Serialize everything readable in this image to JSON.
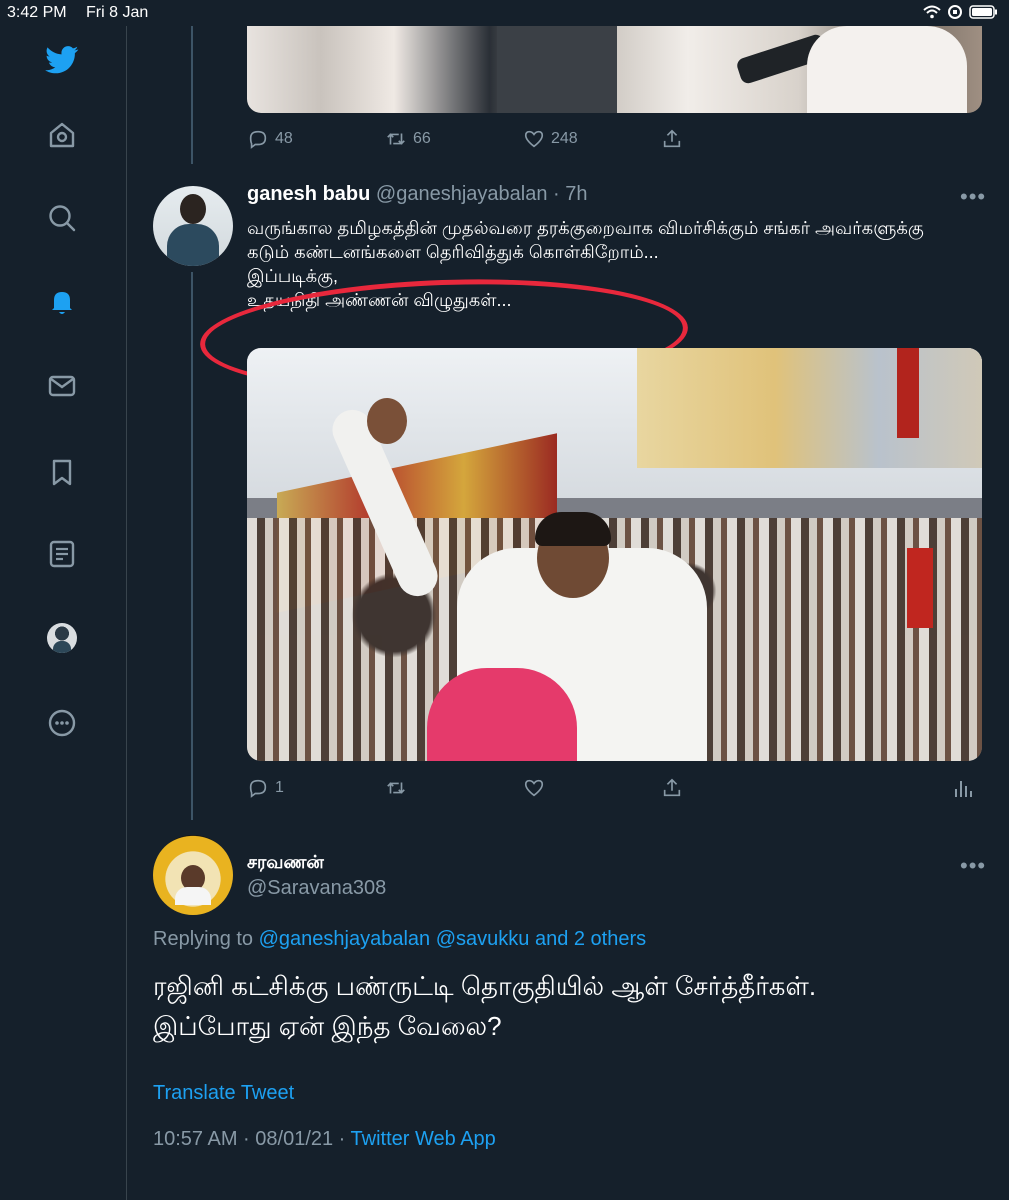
{
  "status_bar": {
    "time": "3:42 PM",
    "date": "Fri 8 Jan"
  },
  "sidebar": {
    "items": [
      {
        "name": "twitter-logo"
      },
      {
        "name": "home"
      },
      {
        "name": "explore"
      },
      {
        "name": "notifications",
        "active": true
      },
      {
        "name": "messages"
      },
      {
        "name": "bookmarks"
      },
      {
        "name": "lists"
      },
      {
        "name": "profile"
      },
      {
        "name": "more"
      }
    ]
  },
  "prev_tweet": {
    "stats": {
      "replies": "48",
      "retweets": "66",
      "likes": "248"
    }
  },
  "tweet": {
    "name": "ganesh babu",
    "handle": "@ganeshjayabalan",
    "time": "· 7h",
    "text": "வருங்கால தமிழகத்தின் முதல்வரை தரக்குறைவாக விமர்சிக்கும் சங்கர் அவர்களுக்கு கடும் கண்டனங்களை தெரிவித்துக் கொள்கிறோம்...\nஇப்படிக்கு,\nஉதயநிதி அண்ணன் விழுதுகள்...",
    "stats": {
      "replies": "1"
    }
  },
  "reply": {
    "name": "சரவணன்",
    "handle": "@Saravana308",
    "replying_prefix": "Replying to",
    "replying_links": "@ganeshjayabalan @savukku and 2 others",
    "text": "ரஜினி கட்சிக்கு பண்ருட்டி தொகுதியில் ஆள் சேர்த்தீர்கள்.\nஇப்போது ஏன் இந்த வேலை?",
    "translate": "Translate Tweet",
    "timestamp": "10:57 AM · 08/01/21 ·",
    "source": "Twitter Web App"
  },
  "colors": {
    "background": "#15202b",
    "accent": "#1da1f2",
    "muted": "#8899a6",
    "annotation": "#e8283c"
  }
}
